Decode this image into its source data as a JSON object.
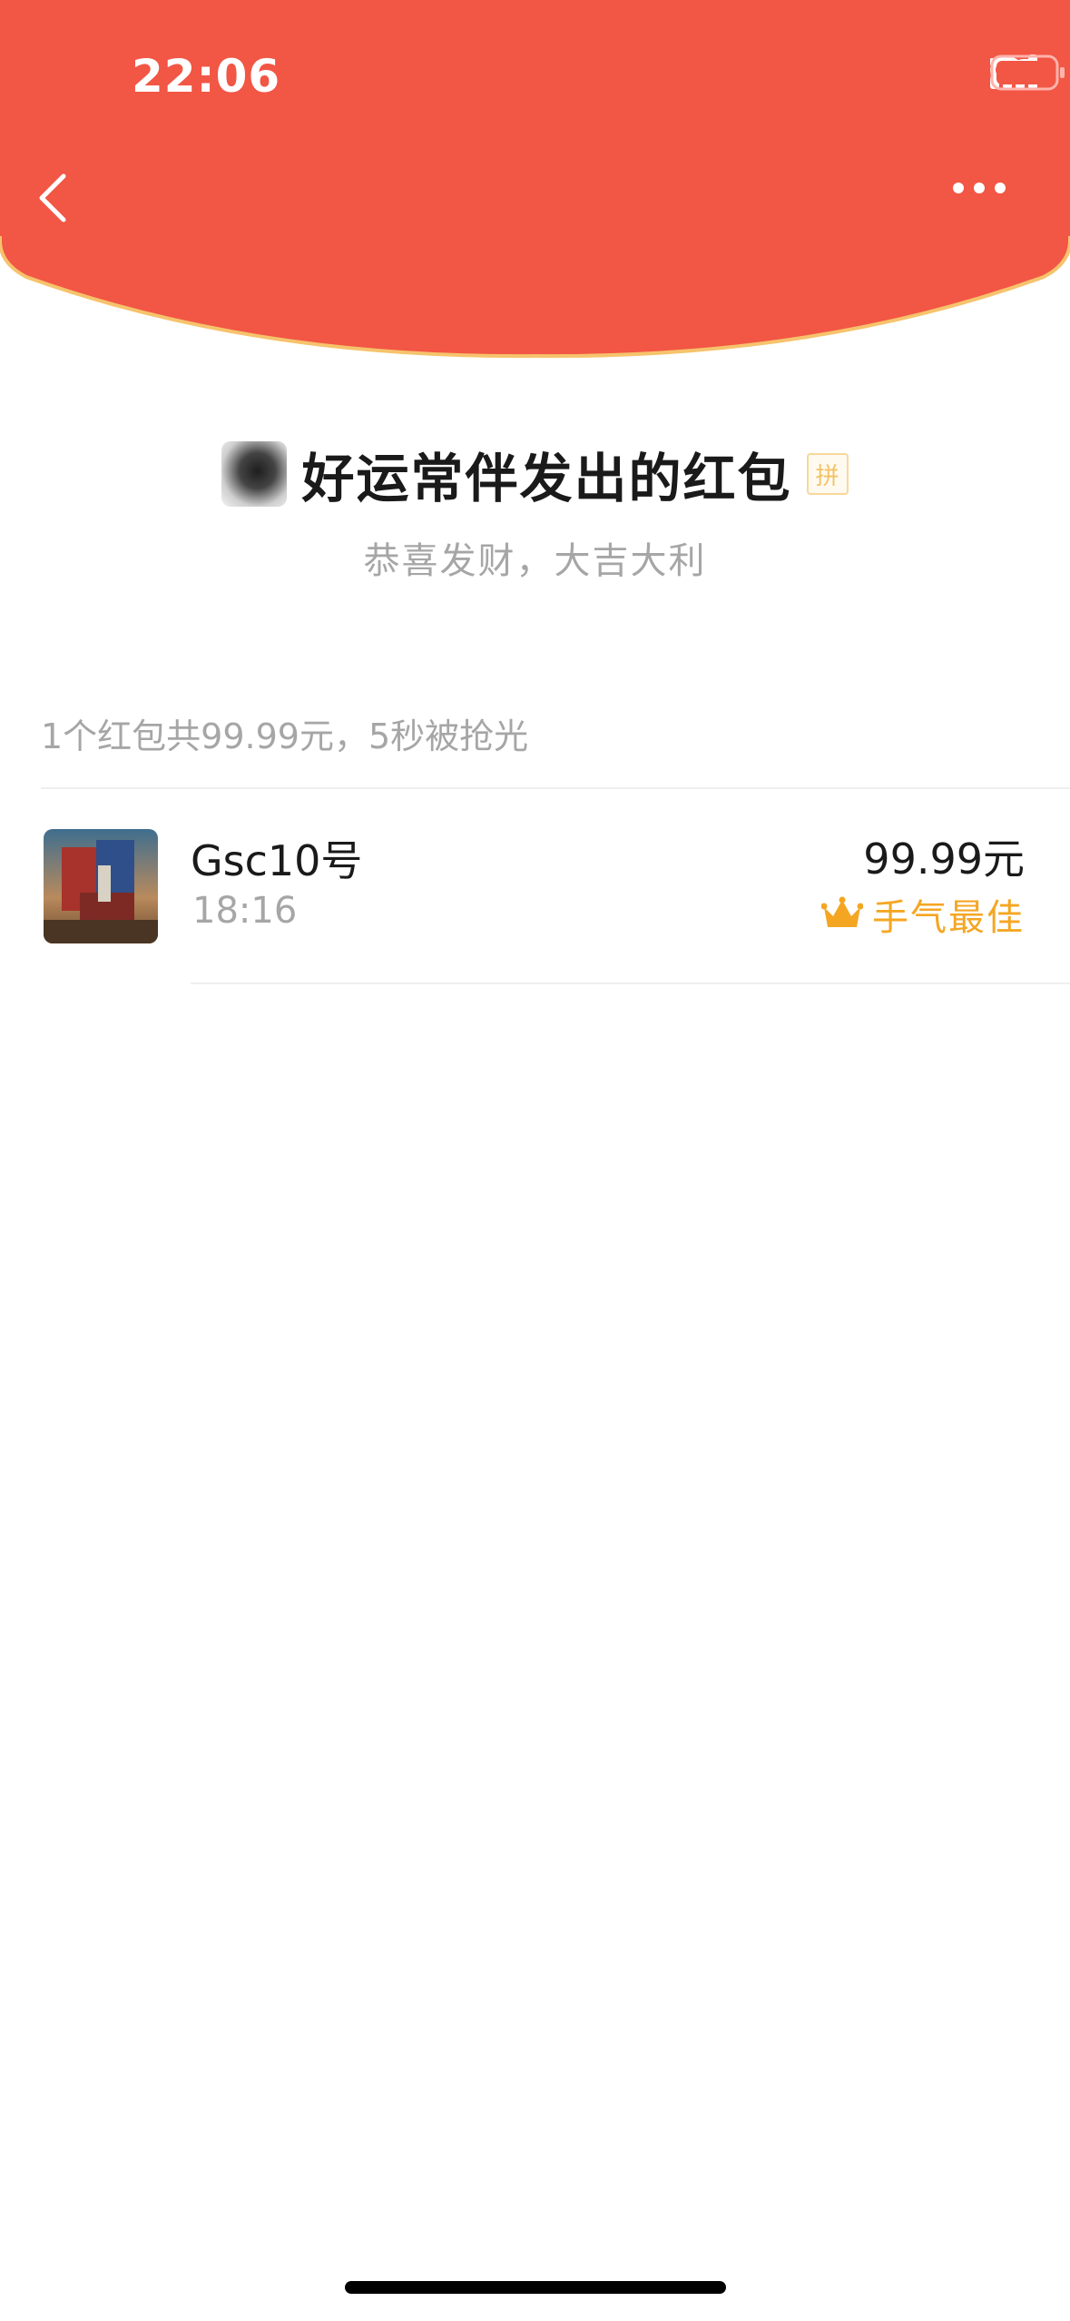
{
  "colors": {
    "header_red": "#F25644",
    "header_edge": "#F6C36C",
    "accent_gold": "#F4A623"
  },
  "status_bar": {
    "time": "22:06",
    "icons": [
      "signal-icon",
      "link-icon",
      "battery-icon"
    ]
  },
  "nav": {
    "back_icon": "chevron-left-icon",
    "more_icon": "ellipsis-icon"
  },
  "packet": {
    "sender_title": "好运常伴发出的红包",
    "badge": "拼",
    "greeting": "恭喜发财，大吉大利",
    "summary": "1个红包共99.99元，5秒被抢光"
  },
  "recipients": [
    {
      "name": "Gsc10号",
      "time": "18:16",
      "amount": "99.99元",
      "tag": "手气最佳",
      "tag_icon": "crown-icon"
    }
  ]
}
